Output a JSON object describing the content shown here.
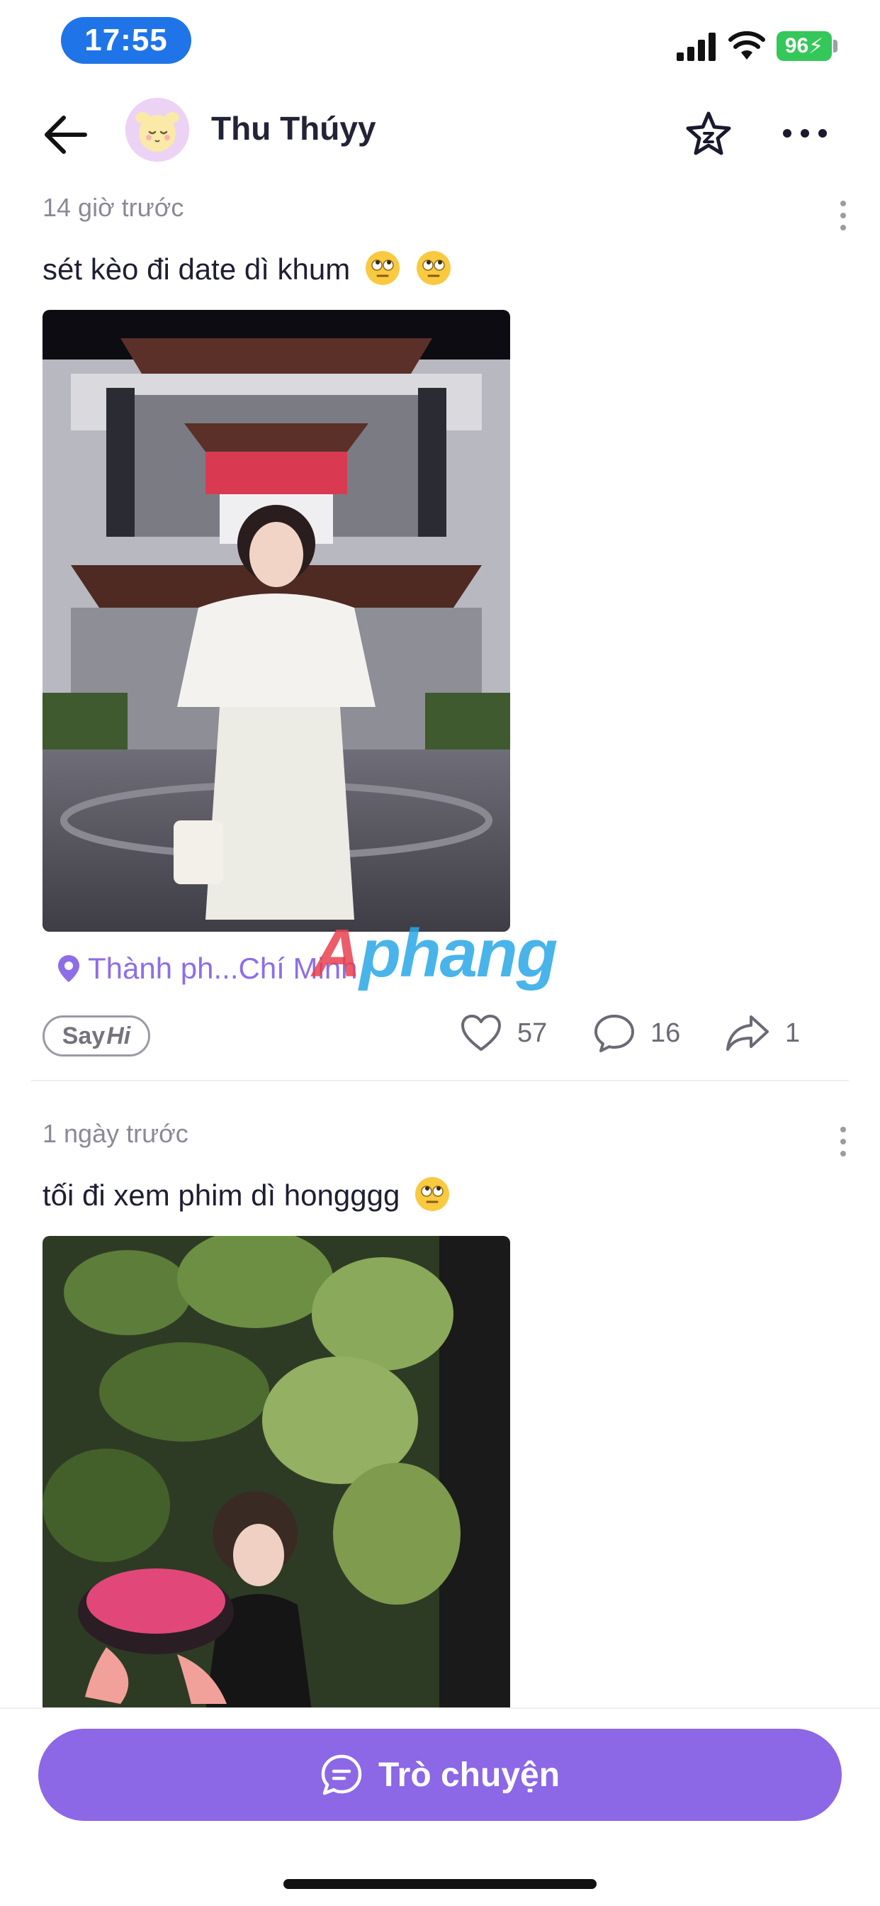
{
  "status_bar": {
    "time": "17:55",
    "battery": "96"
  },
  "header": {
    "profile_name": "Thu Thúyy"
  },
  "posts": [
    {
      "time": "14 giờ trước",
      "caption": "sét kèo đi date dì khum",
      "location": "Thành ph...Chí Minh",
      "sayhi": {
        "say": "Say",
        "hi": "Hi"
      },
      "likes": "57",
      "comments": "16",
      "shares": "1"
    },
    {
      "time": "1 ngày trước",
      "caption": "tối đi xem phim dì hongggg"
    }
  ],
  "watermark": {
    "first": "A",
    "rest": "phang"
  },
  "bottom": {
    "chat_label": "Trò chuyện"
  },
  "colors": {
    "accent": "#8c67e6",
    "status_time_bg": "#1f74e8",
    "battery": "#34c759",
    "location": "#8d6ee8"
  }
}
